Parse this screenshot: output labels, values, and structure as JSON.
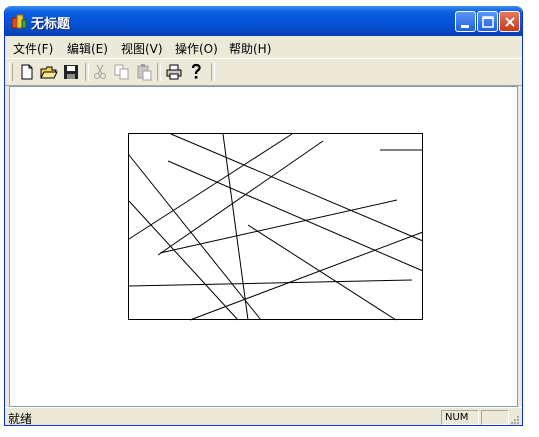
{
  "window": {
    "title": "无标题"
  },
  "menu": {
    "items": [
      "文件(F)",
      "编辑(E)",
      "视图(V)",
      "操作(O)",
      "帮助(H)"
    ]
  },
  "toolbar": {
    "buttons": [
      {
        "icon": "new-file-icon",
        "enabled": true
      },
      {
        "icon": "open-folder-icon",
        "enabled": true
      },
      {
        "icon": "save-icon",
        "enabled": true
      },
      {
        "icon": "cut-icon",
        "enabled": false
      },
      {
        "icon": "copy-icon",
        "enabled": false
      },
      {
        "icon": "paste-icon",
        "enabled": false
      },
      {
        "icon": "print-icon",
        "enabled": true
      },
      {
        "icon": "help-icon",
        "enabled": true
      }
    ]
  },
  "status": {
    "text": "就绪",
    "num": "NUM"
  },
  "colors": {
    "title_bar": "#0754d8",
    "frame": "#ece9d8",
    "close": "#c63a19"
  }
}
